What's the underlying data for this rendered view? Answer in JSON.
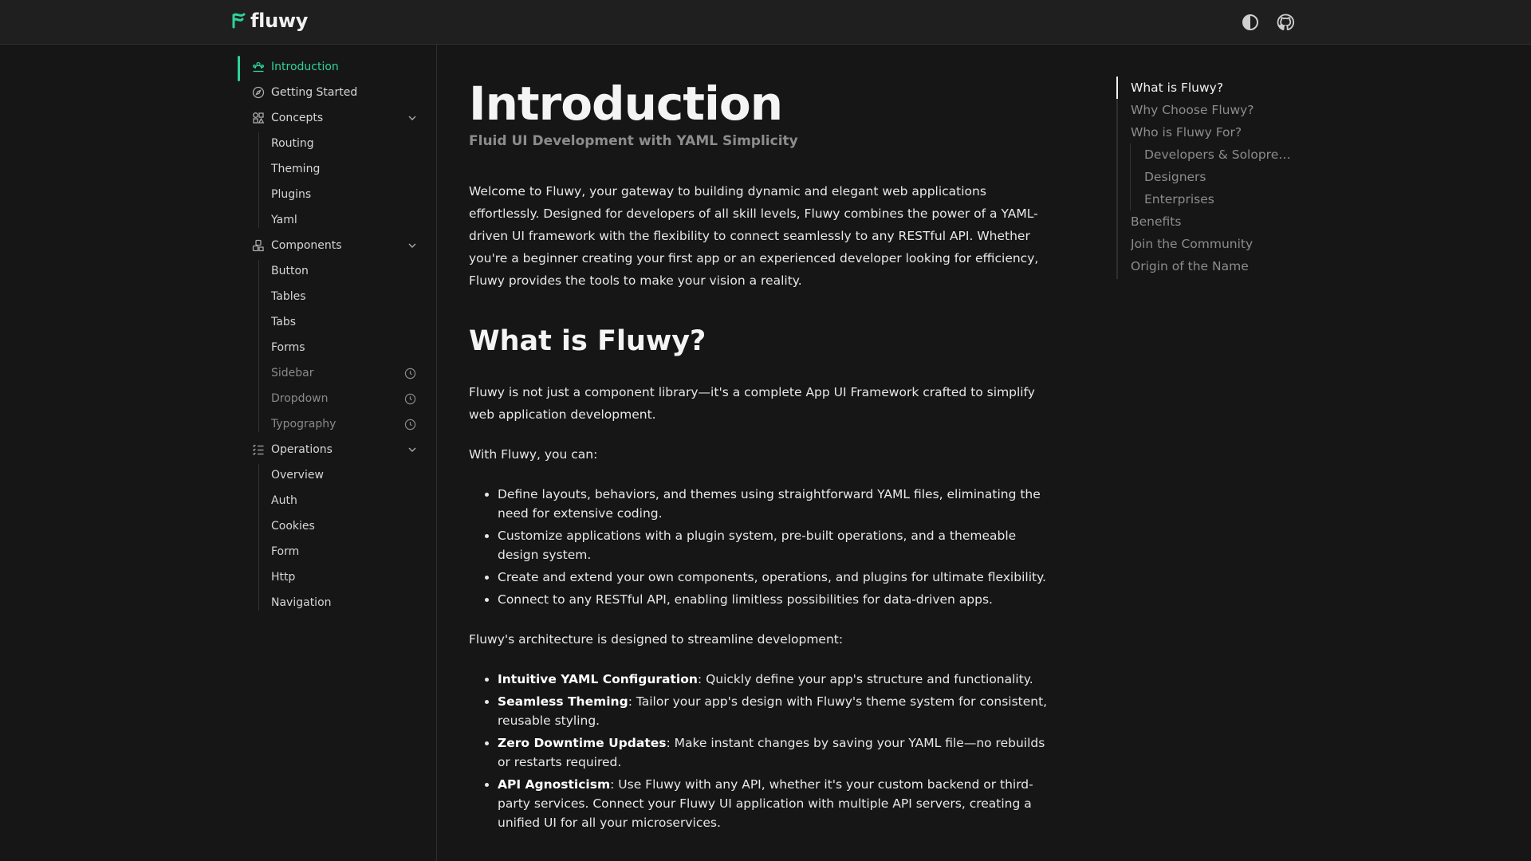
{
  "header": {
    "logo_text": "fluwy",
    "theme_toggle_icon": "half-circle-icon",
    "github_icon": "github-icon"
  },
  "colors": {
    "accent": "#2fd29a",
    "background": "#161616",
    "header_bg": "#1f1f1f"
  },
  "sidebar": {
    "items": [
      {
        "label": "Introduction",
        "icon": "sliders-users-icon",
        "active": true
      },
      {
        "label": "Getting Started",
        "icon": "compass-icon"
      },
      {
        "label": "Concepts",
        "icon": "shapes-icon",
        "expandable": true
      },
      {
        "label": "Components",
        "icon": "components-icon",
        "expandable": true
      },
      {
        "label": "Operations",
        "icon": "list-check-icon",
        "expandable": true
      }
    ],
    "concepts": [
      "Routing",
      "Theming",
      "Plugins",
      "Yaml"
    ],
    "components": [
      {
        "label": "Button"
      },
      {
        "label": "Tables"
      },
      {
        "label": "Tabs"
      },
      {
        "label": "Forms"
      },
      {
        "label": "Sidebar",
        "coming_soon": true
      },
      {
        "label": "Dropdown",
        "coming_soon": true
      },
      {
        "label": "Typography",
        "coming_soon": true
      }
    ],
    "operations": [
      "Overview",
      "Auth",
      "Cookies",
      "Form",
      "Http",
      "Navigation"
    ]
  },
  "main": {
    "title": "Introduction",
    "subtitle": "Fluid UI Development with YAML Simplicity",
    "intro": "Welcome to Fluwy, your gateway to building dynamic and elegant web applications effortlessly. Designed for developers of all skill levels, Fluwy combines the power of a YAML-driven UI framework with the flexibility to connect seamlessly to any RESTful API. Whether you're a beginner creating your first app or an experienced developer looking for efficiency, Fluwy provides the tools to make your vision a reality.",
    "section_title": "What is Fluwy?",
    "section_para1": "Fluwy is not just a component library—it's a complete App UI Framework crafted to simplify web application development.",
    "section_para2": "With Fluwy, you can:",
    "can_list": [
      "Define layouts, behaviors, and themes using straightforward YAML files, eliminating the need for extensive coding.",
      "Customize applications with a plugin system, pre-built operations, and a themeable design system.",
      "Create and extend your own components, operations, and plugins for ultimate flexibility.",
      "Connect to any RESTful API, enabling limitless possibilities for data-driven apps."
    ],
    "arch_para": "Fluwy's architecture is designed to streamline development:",
    "arch_list": [
      {
        "term": "Intuitive YAML Configuration",
        "desc": ": Quickly define your app's structure and functionality."
      },
      {
        "term": "Seamless Theming",
        "desc": ": Tailor your app's design with Fluwy's theme system for consistent, reusable styling."
      },
      {
        "term": "Zero Downtime Updates",
        "desc": ": Make instant changes by saving your YAML file—no rebuilds or restarts required."
      },
      {
        "term": "API Agnosticism",
        "desc": ": Use Fluwy with any API, whether it's your custom backend or third-party services. Connect your Fluwy UI application with multiple API servers, creating a unified UI for all your microservices."
      }
    ]
  },
  "toc": {
    "items": [
      {
        "label": "What is Fluwy?",
        "active": true
      },
      {
        "label": "Why Choose Fluwy?"
      },
      {
        "label": "Who is Fluwy For?"
      },
      {
        "label": "Developers & Solopreneurs",
        "sub": true
      },
      {
        "label": "Designers",
        "sub": true
      },
      {
        "label": "Enterprises",
        "sub": true
      },
      {
        "label": "Benefits"
      },
      {
        "label": "Join the Community"
      },
      {
        "label": "Origin of the Name"
      }
    ]
  }
}
